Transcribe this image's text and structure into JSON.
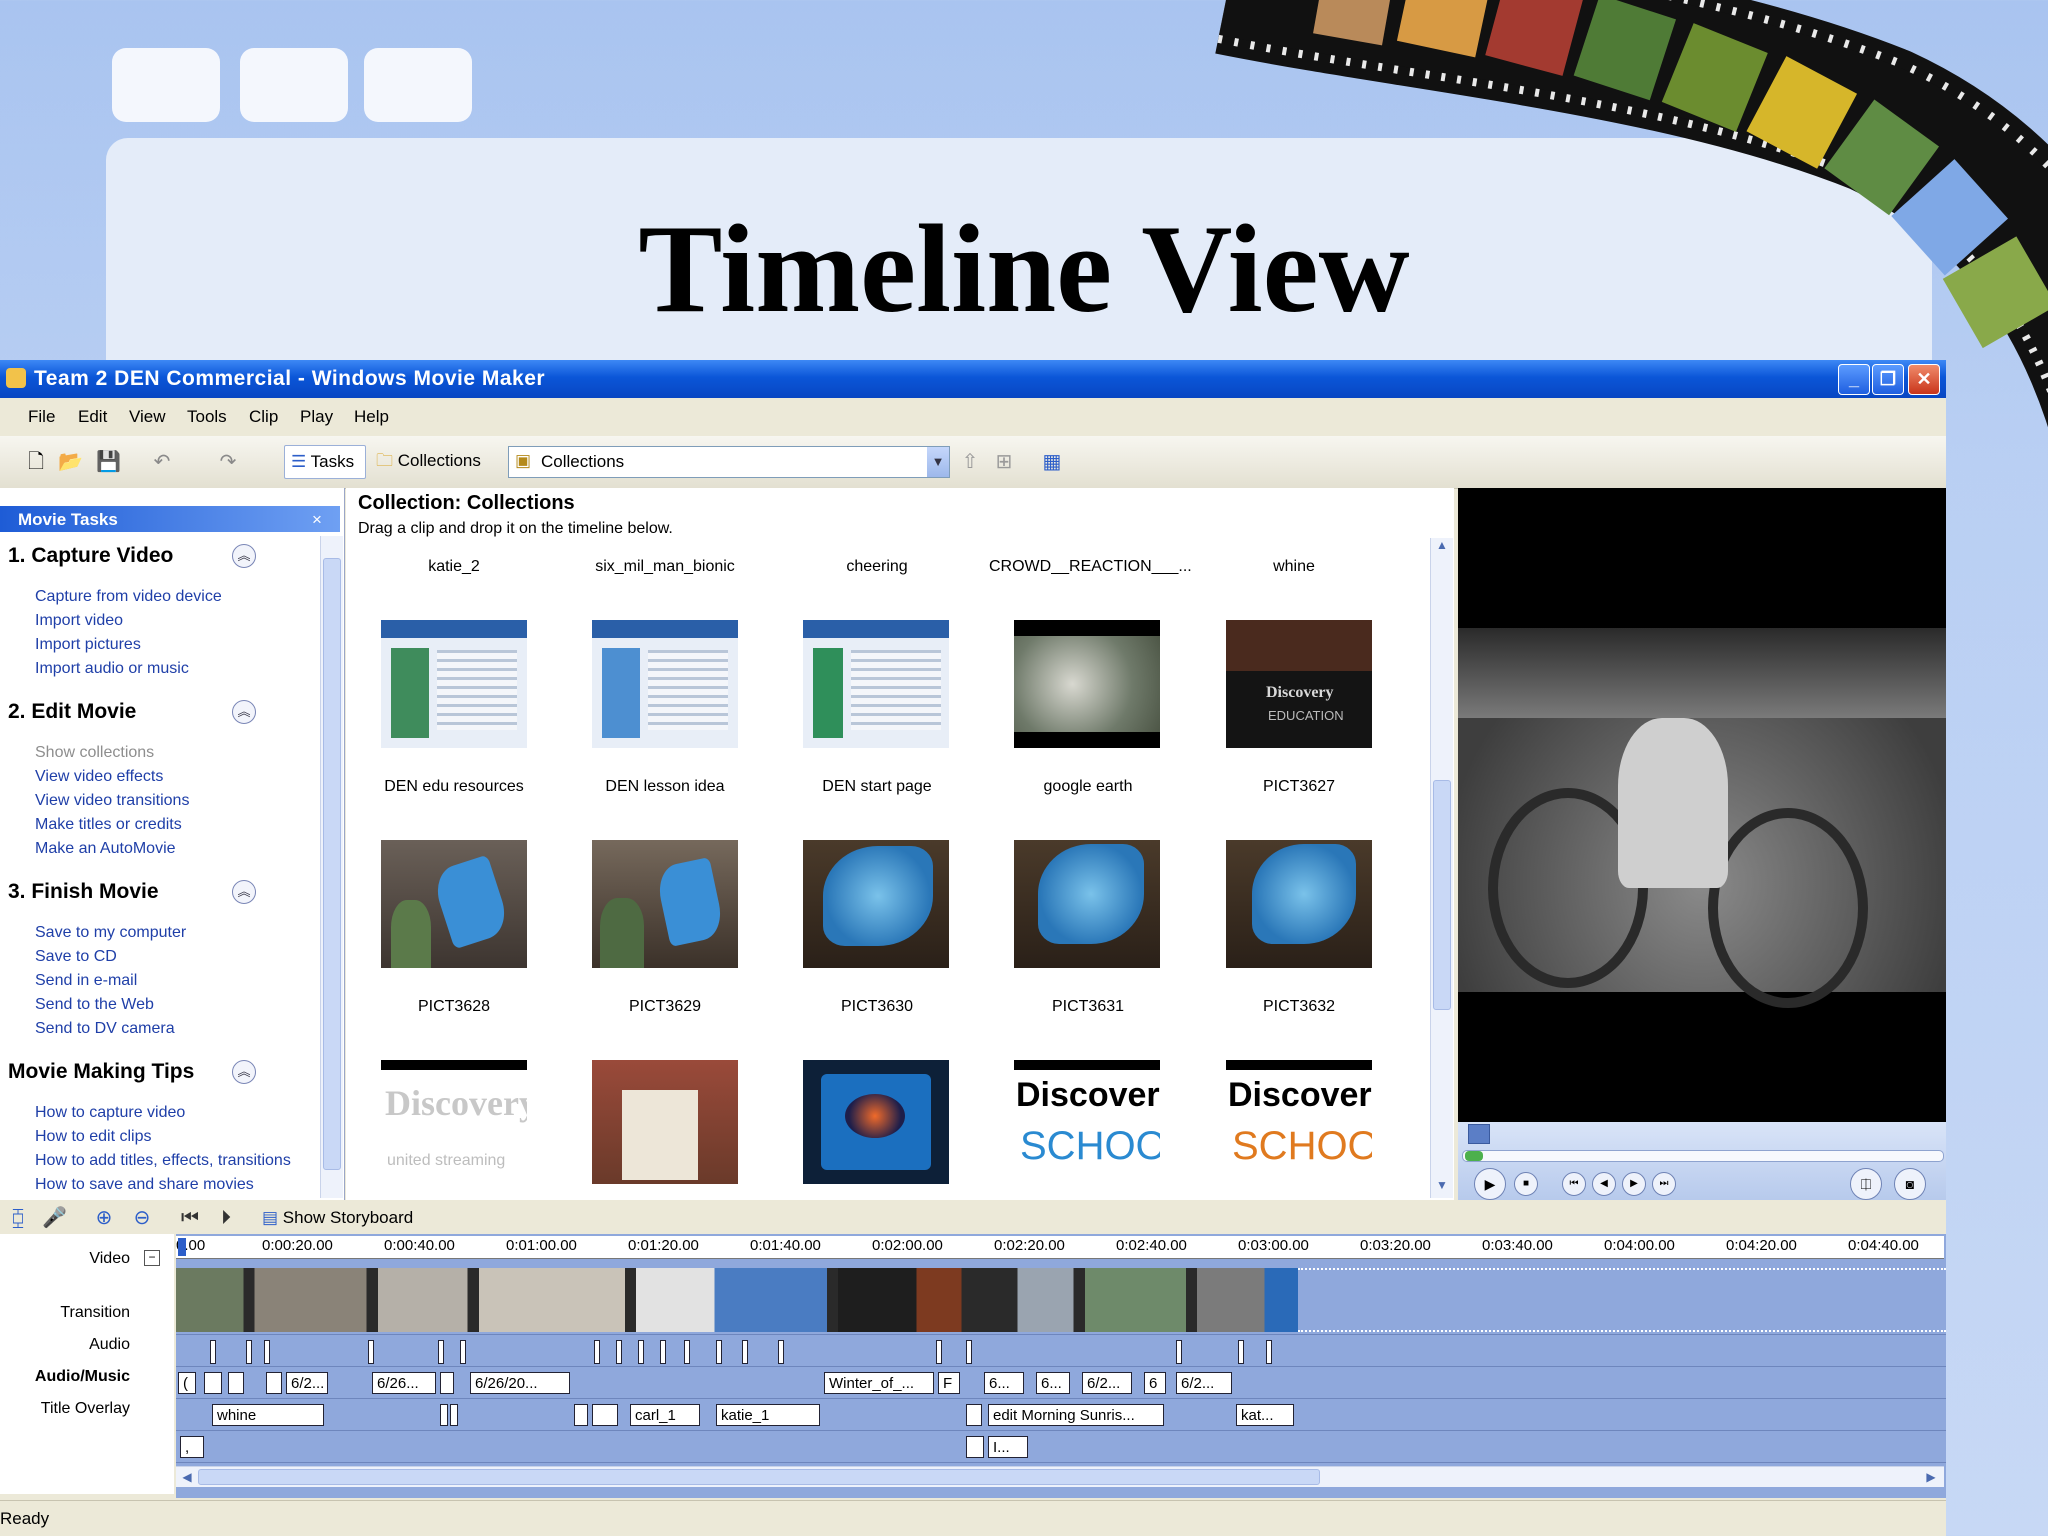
{
  "slide": {
    "title": "Timeline View"
  },
  "window": {
    "title": "Team 2 DEN Commercial - Windows Movie Maker",
    "buttons": {
      "min": "_",
      "max": "❐",
      "close": "✕"
    }
  },
  "menu": [
    "File",
    "Edit",
    "View",
    "Tools",
    "Clip",
    "Play",
    "Help"
  ],
  "toolbar": {
    "tasks": "Tasks",
    "collections": "Collections",
    "combo_value": "Collections"
  },
  "taskpane": {
    "header": "Movie Tasks",
    "close": "×",
    "sections": [
      {
        "title": "1. Capture Video",
        "links": [
          "Capture from video device",
          "Import video",
          "Import pictures",
          "Import audio or music"
        ]
      },
      {
        "title": "2. Edit Movie",
        "links": [
          "Show collections",
          "View video effects",
          "View video transitions",
          "Make titles or credits",
          "Make an AutoMovie"
        ]
      },
      {
        "title": "3. Finish Movie",
        "links": [
          "Save to my computer",
          "Save to CD",
          "Send in e-mail",
          "Send to the Web",
          "Send to DV camera"
        ]
      },
      {
        "title": "Movie Making Tips",
        "links": [
          "How to capture video",
          "How to edit clips",
          "How to add titles, effects, transitions",
          "How to save and share movies"
        ]
      }
    ]
  },
  "collection": {
    "heading": "Collection: Collections",
    "subheading": "Drag a clip and drop it on the timeline below.",
    "top_labels": [
      "katie_2",
      "six_mil_man_bionic",
      "cheering",
      "CROWD__REACTION___...",
      "whine"
    ],
    "row1": [
      "DEN edu resources",
      "DEN lesson idea",
      "DEN start page",
      "google earth",
      "PICT3627"
    ],
    "row2": [
      "PICT3628",
      "PICT3629",
      "PICT3630",
      "PICT3631",
      "PICT3632"
    ],
    "row3_text": [
      "Discovery",
      "united streaming",
      "",
      "",
      "Discovery",
      "SCHOOL",
      "Discovery",
      "SCHOOL"
    ]
  },
  "timeline": {
    "show_storyboard": "Show Storyboard",
    "ruler": [
      "0.00",
      "0:00:20.00",
      "0:00:40.00",
      "0:01:00.00",
      "0:01:20.00",
      "0:01:40.00",
      "0:02:00.00",
      "0:02:20.00",
      "0:02:40.00",
      "0:03:00.00",
      "0:03:20.00",
      "0:03:40.00",
      "0:04:00.00",
      "0:04:20.00",
      "0:04:40.00"
    ],
    "tracks": {
      "video": "Video",
      "transition": "Transition",
      "audio": "Audio",
      "audio_music": "Audio/Music",
      "title_overlay": "Title Overlay"
    },
    "audio_chips": [
      "(",
      "",
      "",
      "",
      "6/2...",
      "6/26...",
      "",
      "6/26/20...",
      "Winter_of_...",
      "F",
      "6...",
      "6...",
      "6/2...",
      "6",
      "6/2..."
    ],
    "music_chips": [
      "whine",
      "",
      "",
      "",
      "",
      "carl_1",
      "katie_1",
      "",
      "edit Morning Sunris...",
      "kat..."
    ],
    "title_chips": [
      ",",
      "",
      "I..."
    ],
    "collapse": "−"
  },
  "status": {
    "text": "Ready"
  },
  "colors": {
    "title_bar": "#0b56d8",
    "timeline_bg": "#8fa8dc",
    "link": "#1f3fa8"
  }
}
